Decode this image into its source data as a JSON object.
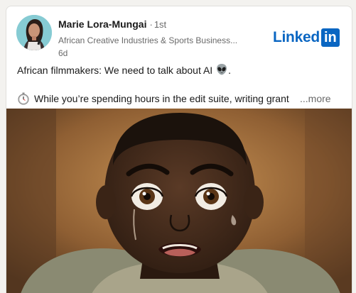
{
  "author": {
    "name": "Marie Lora-Mungai",
    "separator": "·",
    "degree": "1st",
    "headline": "African Creative Industries & Sports Business...",
    "time_ago": "6d"
  },
  "brand": {
    "word": "Linked",
    "box": "in",
    "color": "#0a66c2"
  },
  "post": {
    "line1": "African filmmakers: We need to talk about AI",
    "line1_suffix": ".",
    "line1_emoji": "alien-icon",
    "line2_emoji": "stopwatch-icon",
    "line2": "While you’re spending hours in the edit suite, writing grant",
    "more_label": "...more"
  },
  "media": {
    "alt_icon": "illustration-frightened-man"
  }
}
